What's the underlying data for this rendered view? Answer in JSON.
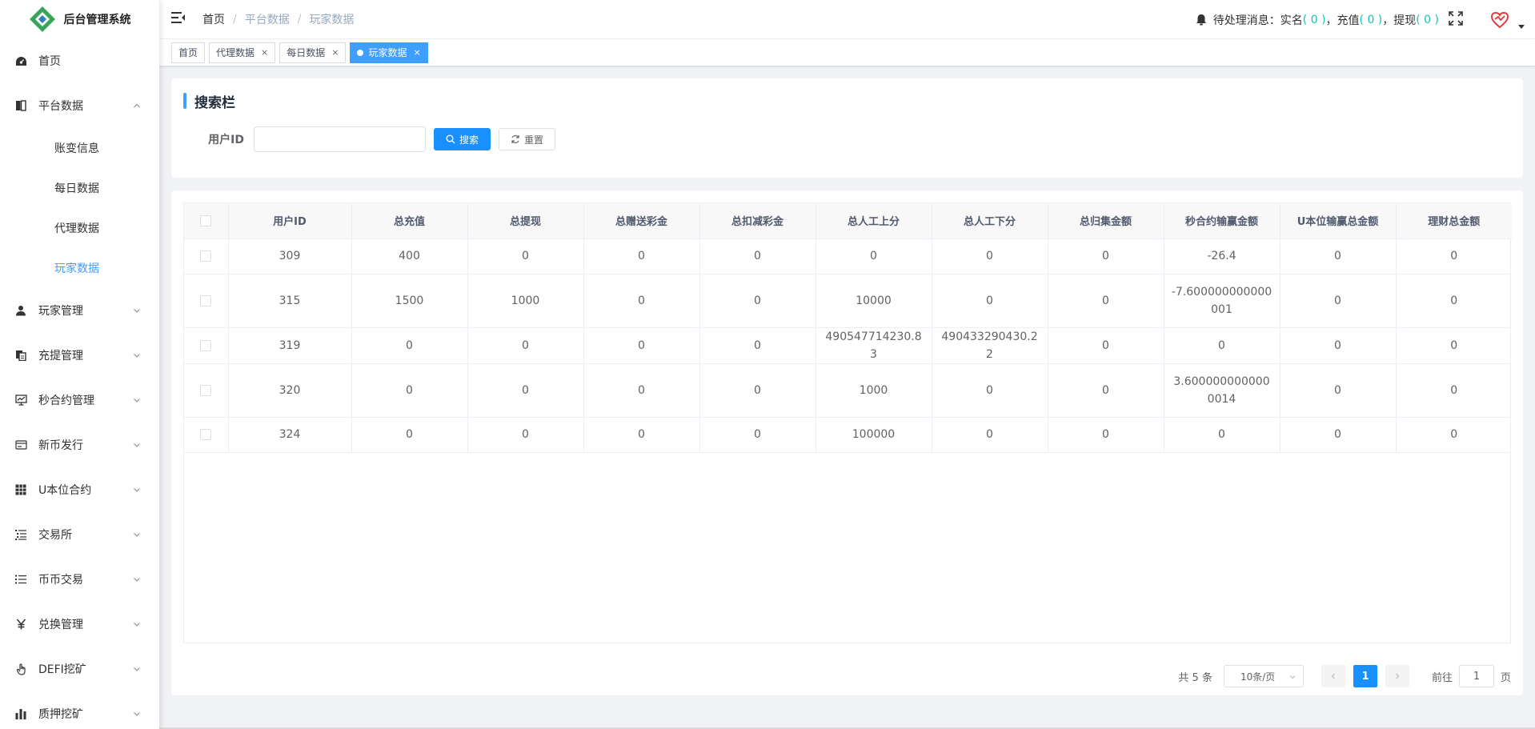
{
  "app": {
    "title": "后台管理系统"
  },
  "sidebar": {
    "items": [
      {
        "label": "首页",
        "icon": "dashboard-icon",
        "expandable": false
      },
      {
        "label": "平台数据",
        "icon": "book-icon",
        "expandable": true,
        "expanded": true,
        "children": [
          {
            "label": "账变信息",
            "active": false
          },
          {
            "label": "每日数据",
            "active": false
          },
          {
            "label": "代理数据",
            "active": false
          },
          {
            "label": "玩家数据",
            "active": true
          }
        ]
      },
      {
        "label": "玩家管理",
        "icon": "user-icon",
        "expandable": true
      },
      {
        "label": "充提管理",
        "icon": "documents-icon",
        "expandable": true
      },
      {
        "label": "秒合约管理",
        "icon": "monitor-icon",
        "expandable": true
      },
      {
        "label": "新币发行",
        "icon": "card-icon",
        "expandable": true
      },
      {
        "label": "U本位合约",
        "icon": "grid-icon",
        "expandable": true
      },
      {
        "label": "交易所",
        "icon": "tree-list-icon",
        "expandable": true
      },
      {
        "label": "币币交易",
        "icon": "list-icon",
        "expandable": true
      },
      {
        "label": "兑换管理",
        "icon": "yen-icon",
        "expandable": true
      },
      {
        "label": "DEFI挖矿",
        "icon": "hand-icon",
        "expandable": true
      },
      {
        "label": "质押挖矿",
        "icon": "bar-chart-icon",
        "expandable": true
      }
    ]
  },
  "navbar": {
    "breadcrumb": [
      "首页",
      "平台数据",
      "玩家数据"
    ],
    "messages": {
      "prefix": "待处理消息：",
      "realname_label": "实名",
      "realname_count": "( 0 )",
      "recharge_label": "，充值",
      "recharge_count": "( 0 )",
      "withdraw_label": "，提现",
      "withdraw_count": "( 0 )"
    }
  },
  "tags": [
    {
      "label": "首页",
      "closable": false,
      "active": false
    },
    {
      "label": "代理数据",
      "closable": true,
      "active": false
    },
    {
      "label": "每日数据",
      "closable": true,
      "active": false
    },
    {
      "label": "玩家数据",
      "closable": true,
      "active": true
    }
  ],
  "search": {
    "title": "搜索栏",
    "user_id_label": "用户ID",
    "user_id_value": "",
    "user_id_placeholder": "",
    "search_button": "搜索",
    "reset_button": "重置"
  },
  "table": {
    "columns": [
      "用户ID",
      "总充值",
      "总提现",
      "总赠送彩金",
      "总扣减彩金",
      "总人工上分",
      "总人工下分",
      "总归集金额",
      "秒合约输赢金额",
      "U本位输赢总金额",
      "理财总金额"
    ],
    "rows": [
      [
        "309",
        "400",
        "0",
        "0",
        "0",
        "0",
        "0",
        "0",
        "-26.4",
        "0",
        "0"
      ],
      [
        "315",
        "1500",
        "1000",
        "0",
        "0",
        "10000",
        "0",
        "0",
        "-7.600000000000001",
        "0",
        "0"
      ],
      [
        "319",
        "0",
        "0",
        "0",
        "0",
        "490547714230.83",
        "490433290430.22",
        "0",
        "0",
        "0",
        "0"
      ],
      [
        "320",
        "0",
        "0",
        "0",
        "0",
        "1000",
        "0",
        "0",
        "3.6000000000000014",
        "0",
        "0"
      ],
      [
        "324",
        "0",
        "0",
        "0",
        "0",
        "100000",
        "0",
        "0",
        "0",
        "0",
        "0"
      ]
    ]
  },
  "pagination": {
    "total_text": "共 5 条",
    "page_size": "10条/页",
    "current_page": "1",
    "goto_prefix": "前往",
    "goto_value": "1",
    "goto_suffix": "页"
  },
  "colors": {
    "primary": "#1890ff",
    "active_menu": "#409eff",
    "accent_count": "#13c2c2"
  }
}
